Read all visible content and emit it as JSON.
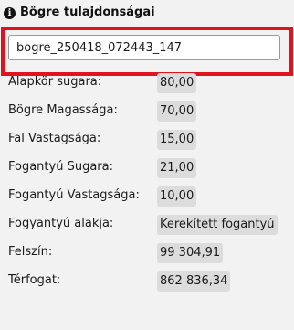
{
  "header": {
    "icon": "info-icon",
    "title": "Bögre tulajdonságai"
  },
  "name_field": {
    "value": "bogre_250418_072443_147",
    "highlight_color": "#e0141c"
  },
  "properties": [
    {
      "label": "Alapkör sugara:",
      "value": "80,00"
    },
    {
      "label": "Bögre Magassága:",
      "value": "70,00"
    },
    {
      "label": "Fal Vastagsága:",
      "value": "15,00"
    },
    {
      "label": "Fogantyú Sugara:",
      "value": "21,00"
    },
    {
      "label": "Fogantyú Vastagsága:",
      "value": "10,00"
    },
    {
      "label": "Fogyantyú alakja:",
      "value": "Kerekített fogantyú"
    },
    {
      "label": "Felszín:",
      "value": "99 304,91"
    },
    {
      "label": "Térfogat:",
      "value": "862 836,34"
    }
  ]
}
